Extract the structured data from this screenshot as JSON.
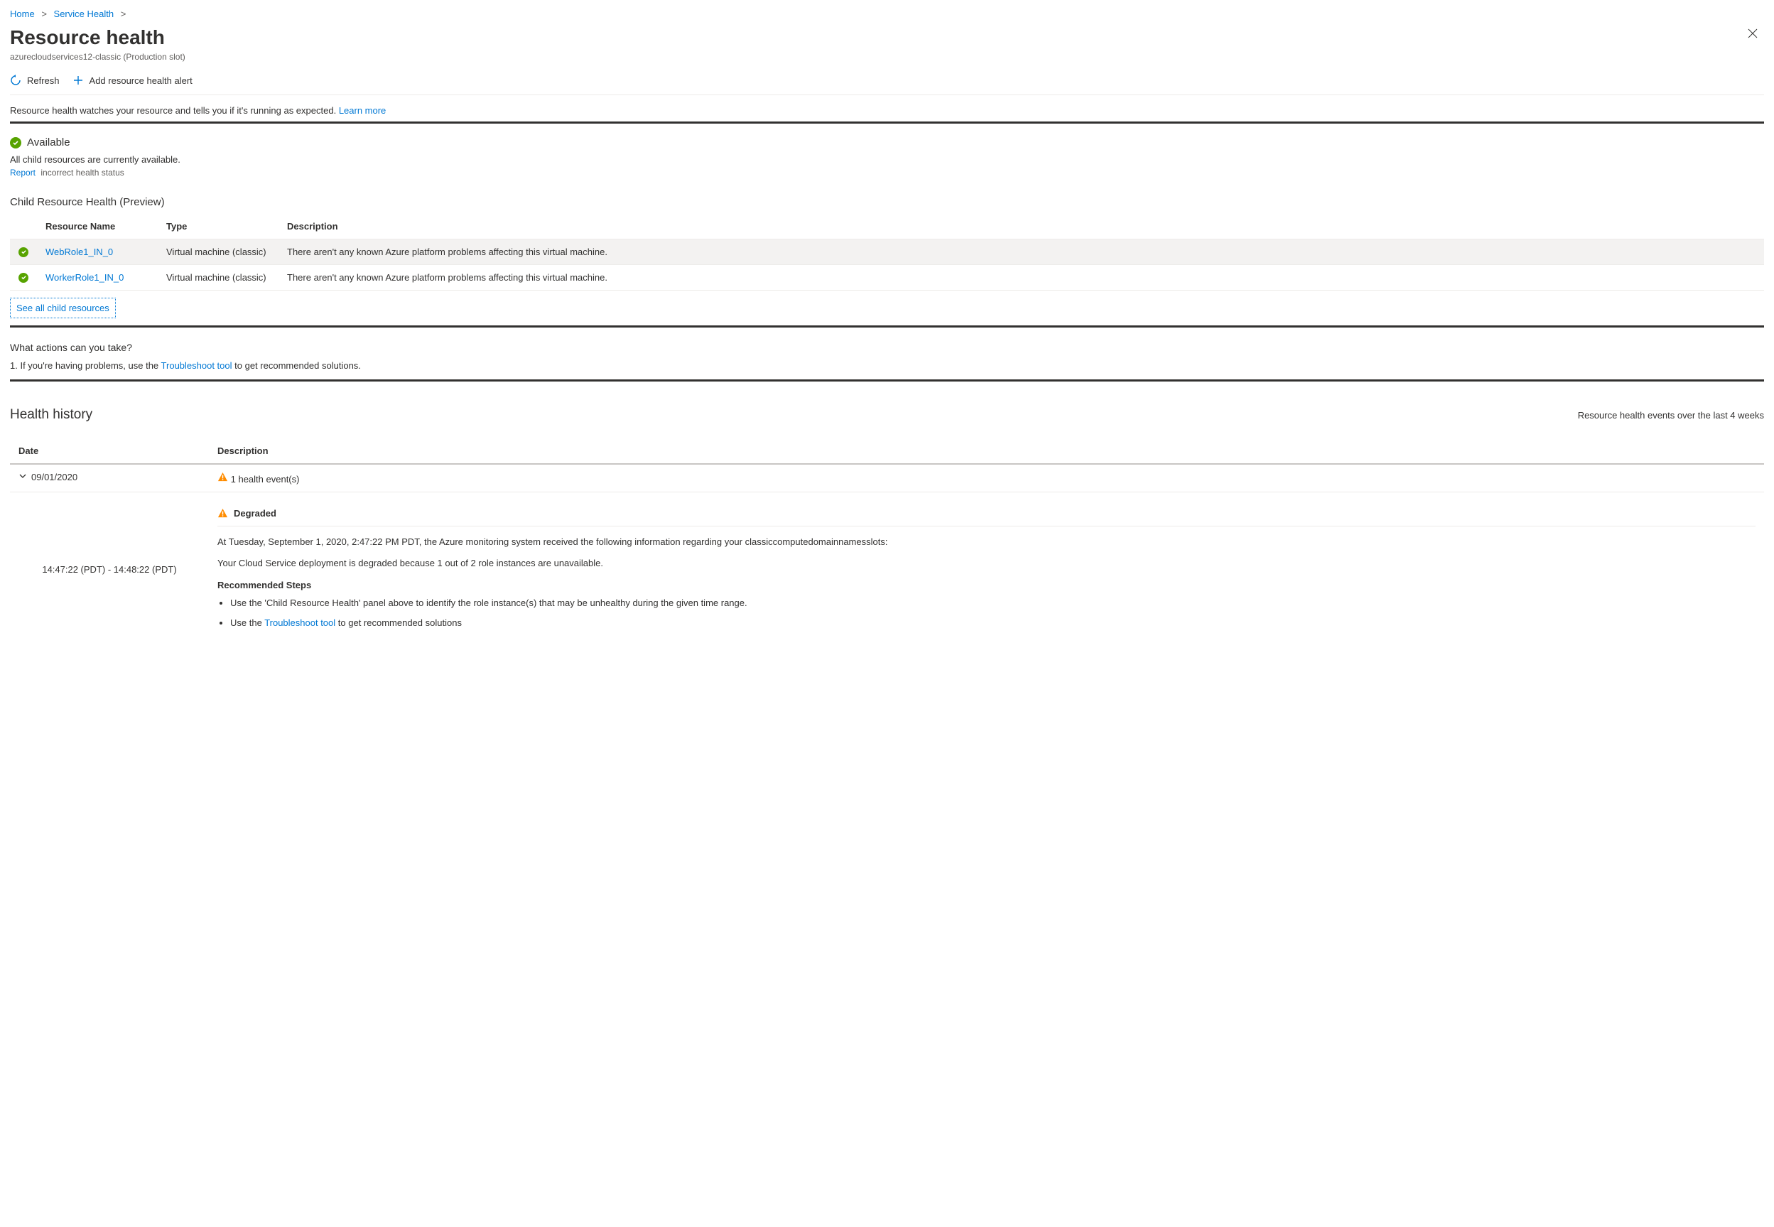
{
  "breadcrumb": {
    "home": "Home",
    "service_health": "Service Health"
  },
  "page": {
    "title": "Resource health",
    "subtitle": "azurecloudservices12-classic (Production slot)"
  },
  "toolbar": {
    "refresh": "Refresh",
    "add_alert": "Add resource health alert"
  },
  "intro": {
    "text": "Resource health watches your resource and tells you if it's running as expected.",
    "learn_more": "Learn more"
  },
  "status": {
    "label": "Available",
    "subtext": "All child resources are currently available.",
    "report_link": "Report",
    "report_text": "incorrect health status"
  },
  "child": {
    "heading": "Child Resource Health (Preview)",
    "columns": {
      "name": "Resource Name",
      "type": "Type",
      "desc": "Description"
    },
    "rows": [
      {
        "name": "WebRole1_IN_0",
        "type": "Virtual machine (classic)",
        "desc": "There aren't any known Azure platform problems affecting this virtual machine."
      },
      {
        "name": "WorkerRole1_IN_0",
        "type": "Virtual machine (classic)",
        "desc": "There aren't any known Azure platform problems affecting this virtual machine."
      }
    ],
    "see_all": "See all child resources"
  },
  "actions": {
    "heading": "What actions can you take?",
    "item_prefix": "1.  If you're having problems, use the ",
    "tool_link": "Troubleshoot tool",
    "item_suffix": " to get recommended solutions."
  },
  "history": {
    "title": "Health history",
    "subtitle": "Resource health events over the last 4 weeks",
    "columns": {
      "date": "Date",
      "desc": "Description"
    },
    "group": {
      "date": "09/01/2020",
      "summary": "1 health event(s)"
    },
    "event": {
      "time_range": "14:47:22 (PDT) - 14:48:22 (PDT)",
      "status": "Degraded",
      "p1": "At Tuesday, September 1, 2020, 2:47:22 PM PDT, the Azure monitoring system received the following information regarding your classiccomputedomainnamesslots:",
      "p2": "Your Cloud Service deployment is degraded because 1 out of 2 role instances are unavailable.",
      "rec_title": "Recommended Steps",
      "step1": "Use the 'Child Resource Health' panel above to identify the role instance(s) that may be unhealthy during the given time range.",
      "step2_prefix": "Use the ",
      "step2_link": "Troubleshoot tool",
      "step2_suffix": " to get recommended solutions"
    }
  }
}
